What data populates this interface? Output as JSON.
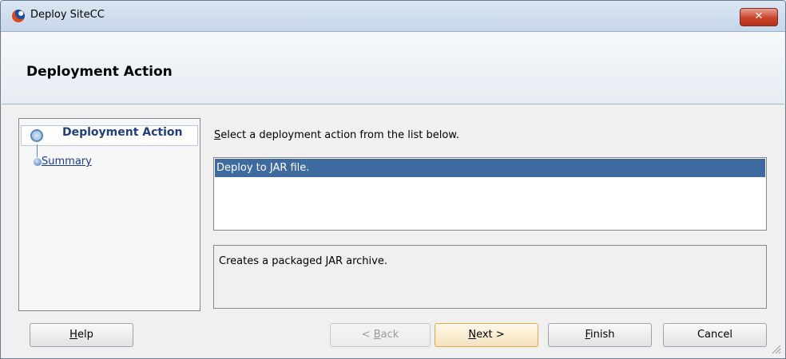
{
  "window": {
    "title": "Deploy SiteCC",
    "close_label": "✕"
  },
  "header": {
    "title": "Deployment Action"
  },
  "nav": {
    "items": [
      {
        "label": "Deployment Action",
        "active": true
      },
      {
        "label": "Summary",
        "active": false
      }
    ]
  },
  "main": {
    "instruction": "Select a deployment action from the list below.",
    "list_items": [
      "Deploy to JAR file."
    ],
    "description": "Creates a packaged JAR archive."
  },
  "buttons": {
    "help": "Help",
    "back": "< Back",
    "next": "Next >",
    "finish": "Finish",
    "cancel": "Cancel"
  },
  "colors": {
    "selection": "#3f6aa0",
    "link": "#1a3e8a",
    "close": "#c8442b",
    "default_button_border": "#e8a646"
  }
}
